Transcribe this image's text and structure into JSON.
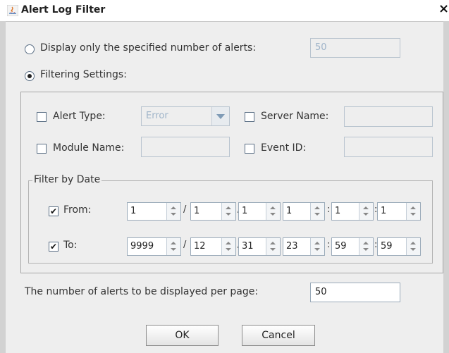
{
  "window": {
    "title": "Alert Log Filter",
    "close_glyph": "×"
  },
  "display_count": {
    "label": "Display only the specified number of alerts:",
    "value": "50",
    "selected": false
  },
  "filtering": {
    "label": "Filtering Settings:",
    "selected": true
  },
  "alert_type": {
    "label": "Alert Type:",
    "value": "Error",
    "checked": false
  },
  "server_name": {
    "label": "Server Name:",
    "value": "",
    "checked": false
  },
  "module_name": {
    "label": "Module Name:",
    "value": "",
    "checked": false
  },
  "event_id": {
    "label": "Event ID:",
    "value": "",
    "checked": false
  },
  "date_filter": {
    "legend": "Filter by Date",
    "from": {
      "label": "From:",
      "checked": true,
      "values": [
        "1",
        "1",
        "1",
        "1",
        "1",
        "1"
      ]
    },
    "to": {
      "label": "To:",
      "checked": true,
      "values": [
        "9999",
        "12",
        "31",
        "23",
        "59",
        "59"
      ]
    },
    "separators": [
      "/",
      "/",
      "",
      ":",
      ":"
    ]
  },
  "per_page": {
    "label": "The number of alerts to be displayed per page:",
    "value": "50"
  },
  "buttons": {
    "ok": "OK",
    "cancel": "Cancel"
  },
  "check_glyph": "✔"
}
